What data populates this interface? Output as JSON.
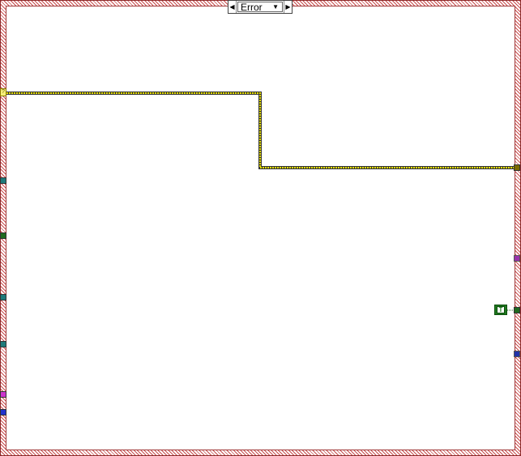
{
  "case_selector": {
    "value": "Error",
    "prev_glyph": "◀",
    "next_glyph": "▶",
    "dropdown_glyph": "▼"
  },
  "constant_true": {
    "label": "T"
  },
  "error_tunnel": {
    "glyph": "?"
  },
  "colors": {
    "frame_hatch": "#c84b4b",
    "error_wire": "#e8e000",
    "teal_tunnel": "#1e7a7a",
    "green_tunnel": "#1f6a1f",
    "magenta_tunnel": "#cc33cc",
    "blue_tunnel": "#2233cc",
    "olive_tunnel": "#7a6a00",
    "purple_tunnel": "#9933aa",
    "navy_tunnel": "#2233aa"
  }
}
